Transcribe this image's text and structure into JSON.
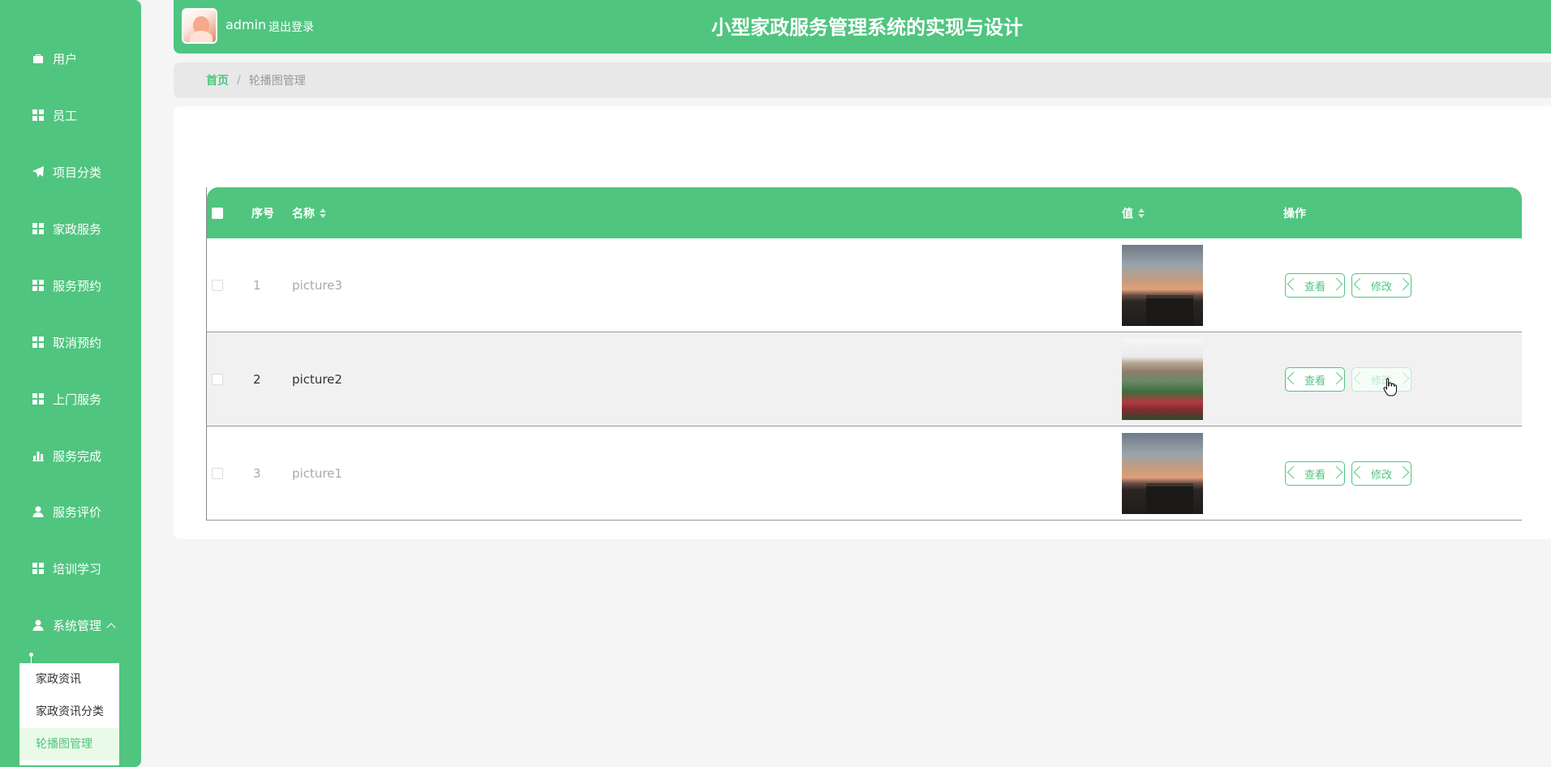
{
  "sidebar": {
    "items": [
      {
        "label": "用户",
        "icon": "briefcase-icon"
      },
      {
        "label": "员工",
        "icon": "grid-icon"
      },
      {
        "label": "项目分类",
        "icon": "paper-plane-icon"
      },
      {
        "label": "家政服务",
        "icon": "grid-icon"
      },
      {
        "label": "服务预约",
        "icon": "grid-icon"
      },
      {
        "label": "取消预约",
        "icon": "grid-icon"
      },
      {
        "label": "上门服务",
        "icon": "grid-icon"
      },
      {
        "label": "服务完成",
        "icon": "bar-chart-icon"
      },
      {
        "label": "服务评价",
        "icon": "user-icon"
      },
      {
        "label": "培训学习",
        "icon": "grid-icon"
      },
      {
        "label": "系统管理",
        "icon": "user-icon"
      }
    ],
    "submenu": [
      {
        "label": "家政资讯"
      },
      {
        "label": "家政资讯分类"
      },
      {
        "label": "轮播图管理"
      }
    ]
  },
  "header": {
    "username": "admin",
    "logout": "退出登录",
    "title": "小型家政服务管理系统的实现与设计"
  },
  "breadcrumb": {
    "home": "首页",
    "separator": "/",
    "current": "轮播图管理"
  },
  "table": {
    "columns": {
      "index": "序号",
      "name": "名称",
      "value": "值",
      "actions": "操作"
    },
    "rows": [
      {
        "index": "1",
        "name": "picture3",
        "image": "dusk-building-photo"
      },
      {
        "index": "2",
        "name": "picture2",
        "image": "garden-building-photo"
      },
      {
        "index": "3",
        "name": "picture1",
        "image": "dusk-building-photo"
      }
    ],
    "view_label": "查看",
    "edit_label": "修改"
  },
  "colors": {
    "accent": "#50c57f",
    "submenu_active_bg": "#e9fbe8"
  }
}
